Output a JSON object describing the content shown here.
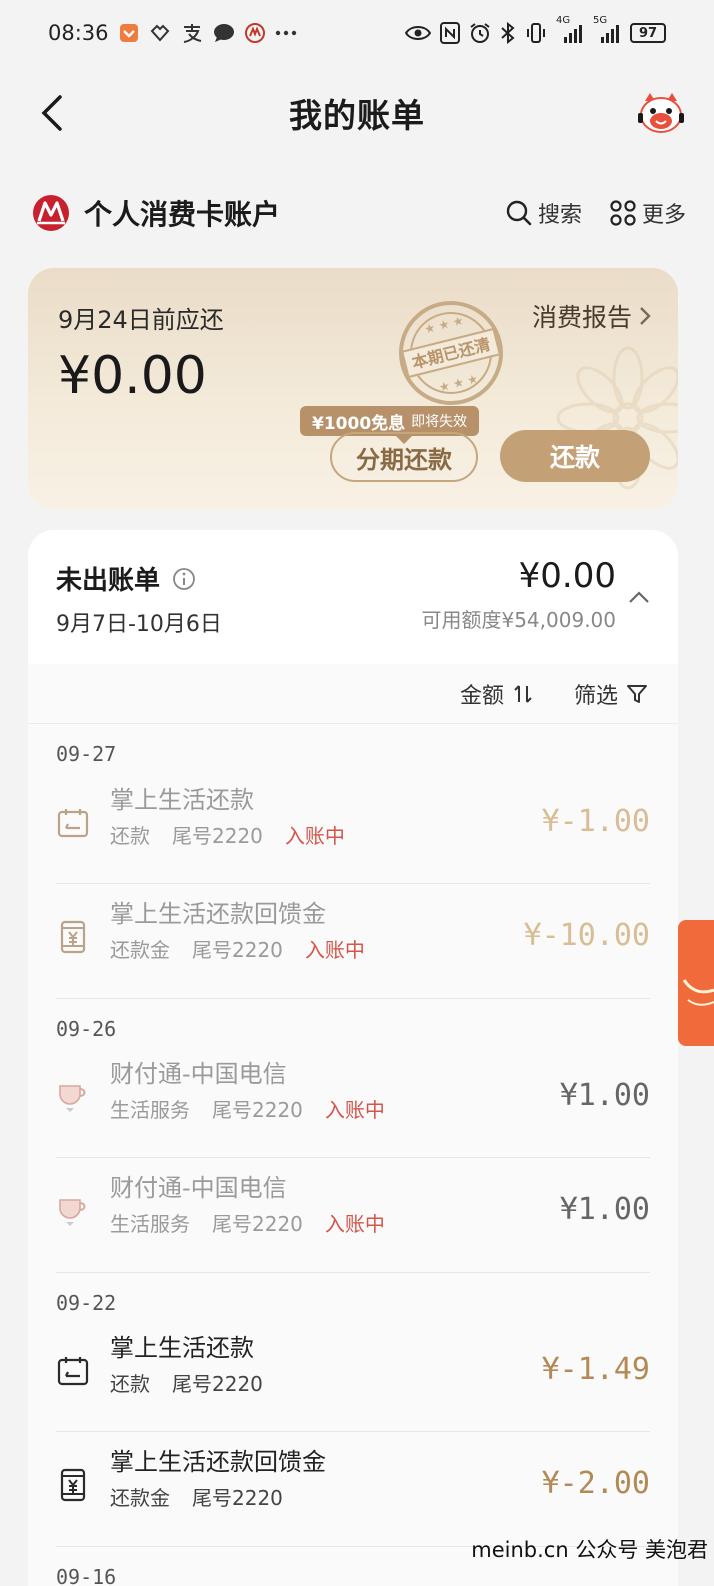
{
  "status_bar": {
    "time": "08:36",
    "network_4g": "4G",
    "network_5g": "5G",
    "battery": "97"
  },
  "header": {
    "title": "我的账单"
  },
  "account": {
    "name": "个人消费卡账户",
    "search_label": "搜索",
    "more_label": "更多"
  },
  "repay_card": {
    "due_label": "9月24日前应还",
    "due_amount": "¥0.00",
    "report_label": "消费报告",
    "stamp_text": "本期已还清",
    "promo_main": "¥1000免息",
    "promo_sub": "即将失效",
    "installment_label": "分期还款",
    "repay_label": "还款"
  },
  "bill": {
    "title": "未出账单",
    "period": "9月7日-10月6日",
    "total": "¥0.00",
    "limit": "可用额度¥54,009.00",
    "sort_label": "金额",
    "filter_label": "筛选"
  },
  "groups": [
    {
      "date": "09-27",
      "items": [
        {
          "title": "掌上生活还款",
          "category": "还款",
          "card": "尾号2220",
          "status": "入账中",
          "amount": "¥-1.00"
        },
        {
          "title": "掌上生活还款回馈金",
          "category": "还款金",
          "card": "尾号2220",
          "status": "入账中",
          "amount": "¥-10.00"
        }
      ]
    },
    {
      "date": "09-26",
      "items": [
        {
          "title": "财付通-中国电信",
          "category": "生活服务",
          "card": "尾号2220",
          "status": "入账中",
          "amount": "¥1.00"
        },
        {
          "title": "财付通-中国电信",
          "category": "生活服务",
          "card": "尾号2220",
          "status": "入账中",
          "amount": "¥1.00"
        }
      ]
    },
    {
      "date": "09-22",
      "items": [
        {
          "title": "掌上生活还款",
          "category": "还款",
          "card": "尾号2220",
          "amount": "¥-1.49"
        },
        {
          "title": "掌上生活还款回馈金",
          "category": "还款金",
          "card": "尾号2220",
          "amount": "¥-2.00"
        }
      ]
    },
    {
      "date": "09-16",
      "items": []
    }
  ],
  "watermark": "meinb.cn 公众号 美泡君"
}
